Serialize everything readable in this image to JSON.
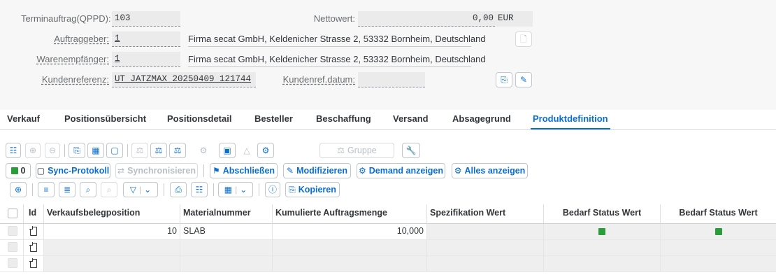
{
  "header": {
    "terminauftrag": {
      "label": "Terminauftrag(QPPD):",
      "value": "103"
    },
    "nettowert": {
      "label": "Nettowert:",
      "value": "0,00",
      "currency": "EUR"
    },
    "auftraggeber": {
      "label": "Auftraggeber:",
      "value": "1",
      "description": "Firma secat GmbH, Keldenicher Strasse 2, 53332 Bornheim, Deutschland"
    },
    "warenempfaenger": {
      "label": "Warenempfänger:",
      "value": "1",
      "description": "Firma secat GmbH, Keldenicher Strasse 2, 53332 Bornheim, Deutschland"
    },
    "kundenreferenz": {
      "label": "Kundenreferenz:",
      "value": "UT_JATZMAX_20250409_121744"
    },
    "kundenref_datum": {
      "label": "Kundenref.datum:",
      "value": ""
    }
  },
  "tabs": [
    {
      "label": "Verkauf"
    },
    {
      "label": "Positionsübersicht"
    },
    {
      "label": "Positionsdetail"
    },
    {
      "label": "Besteller"
    },
    {
      "label": "Beschaffung"
    },
    {
      "label": "Versand"
    },
    {
      "label": "Absagegrund"
    },
    {
      "label": "Produktdefinition",
      "active": true
    }
  ],
  "toolbar1": {
    "gruppe_label": "Gruppe"
  },
  "toolbar2": {
    "count": "0",
    "sync_protokoll": "Sync-Protokoll",
    "synchronisieren": "Synchronisieren",
    "abschliessen": "Abschließen",
    "modifizieren": "Modifizieren",
    "demand_anzeigen": "Demand anzeigen",
    "alles_anzeigen": "Alles anzeigen"
  },
  "toolbar3": {
    "kopieren": "Kopieren"
  },
  "table": {
    "columns": [
      "Id",
      "Verkaufsbelegposition",
      "Materialnummer",
      "Kumulierte Auftragsmenge",
      "Spezifikation Wert",
      "Bedarf Status Wert",
      "Bedarf Status Wert"
    ],
    "rows": [
      {
        "position": "10",
        "material": "SLAB",
        "menge": "10,000",
        "spez": "",
        "status1": "green",
        "status2": "green"
      },
      {
        "position": "",
        "material": "",
        "menge": "",
        "spez": "",
        "status1": "",
        "status2": ""
      },
      {
        "position": "",
        "material": "",
        "menge": "",
        "spez": "",
        "status1": "",
        "status2": ""
      }
    ]
  },
  "colors": {
    "accent": "#0a6ed1",
    "status_green": "#2b9c3c",
    "header_bg": "#f7f7f7"
  },
  "icons": {
    "doc": "document-icon",
    "copy": "copy-icon",
    "edit": "edit-icon"
  }
}
